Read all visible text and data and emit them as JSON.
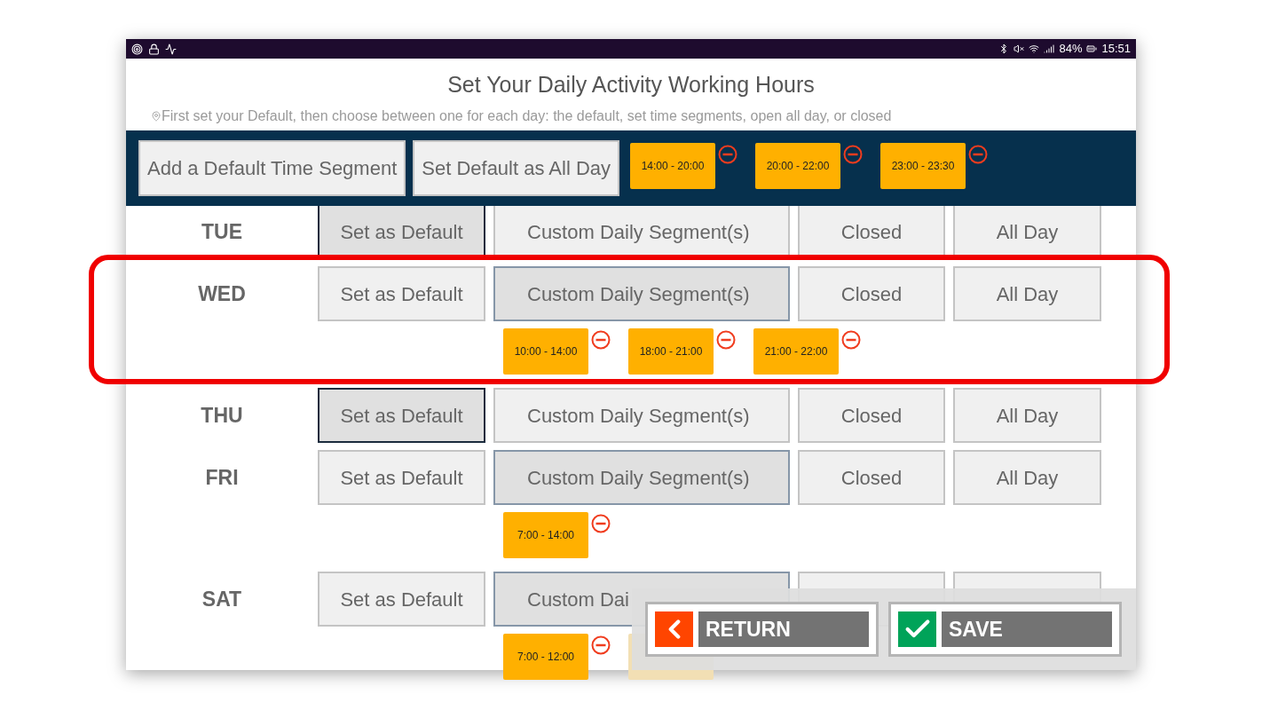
{
  "status_bar": {
    "battery": "84%",
    "time": "15:51"
  },
  "title": "Set Your Daily Activity Working Hours",
  "hint": "First set your Default, then choose between one for each day: the default, set time segments, open all day, or closed",
  "default_bar": {
    "buttons": [
      "Add a Default Time Segment",
      "Set Default as All Day"
    ],
    "segments": [
      "14:00 - 20:00",
      "20:00 - 22:00",
      "23:00 - 23:30"
    ]
  },
  "days": [
    {
      "day": "TUE",
      "highlighted": false,
      "options": [
        {
          "kind": "default",
          "label": "Set as Default",
          "selected": true
        },
        {
          "kind": "custom",
          "label": "Custom Daily Segment(s)",
          "selected": false
        },
        {
          "kind": "closed",
          "label": "Closed",
          "selected": false
        },
        {
          "kind": "all_day",
          "label": "All Day",
          "selected": false
        }
      ]
    },
    {
      "day": "WED",
      "highlighted": true,
      "options": [
        {
          "kind": "default",
          "label": "Set as Default",
          "selected": false
        },
        {
          "kind": "custom",
          "label": "Custom Daily Segment(s)",
          "selected": true
        },
        {
          "kind": "closed",
          "label": "Closed",
          "selected": false
        },
        {
          "kind": "all_day",
          "label": "All Day",
          "selected": false
        }
      ],
      "segments": [
        {
          "label": "10:00 - 14:00"
        },
        {
          "label": "18:00 - 21:00"
        },
        {
          "label": "21:00 - 22:00"
        }
      ]
    },
    {
      "day": "THU",
      "highlighted": false,
      "options": [
        {
          "kind": "default",
          "label": "Set as Default",
          "selected": true
        },
        {
          "kind": "custom",
          "label": "Custom Daily Segment(s)",
          "selected": false
        },
        {
          "kind": "closed",
          "label": "Closed",
          "selected": false
        },
        {
          "kind": "all_day",
          "label": "All Day",
          "selected": false
        }
      ]
    },
    {
      "day": "FRI",
      "highlighted": false,
      "options": [
        {
          "kind": "default",
          "label": "Set as Default",
          "selected": false
        },
        {
          "kind": "custom",
          "label": "Custom Daily Segment(s)",
          "selected": true
        },
        {
          "kind": "closed",
          "label": "Closed",
          "selected": false
        },
        {
          "kind": "all_day",
          "label": "All Day",
          "selected": false
        }
      ],
      "segments": [
        {
          "label": "7:00 - 14:00"
        }
      ]
    },
    {
      "day": "SAT",
      "highlighted": false,
      "options": [
        {
          "kind": "default",
          "label": "Set as Default",
          "selected": false
        },
        {
          "kind": "custom",
          "label": "Custom Dai",
          "selected": true
        },
        {
          "kind": "closed",
          "selected": false
        },
        {
          "kind": "all_day",
          "selected": false
        }
      ],
      "segments": [
        {
          "label": "7:00 - 12:00"
        },
        {
          "kind": "covered"
        }
      ]
    }
  ],
  "actions": [
    {
      "kind": "return",
      "label": "RETURN"
    },
    {
      "kind": "save",
      "label": "SAVE"
    }
  ]
}
